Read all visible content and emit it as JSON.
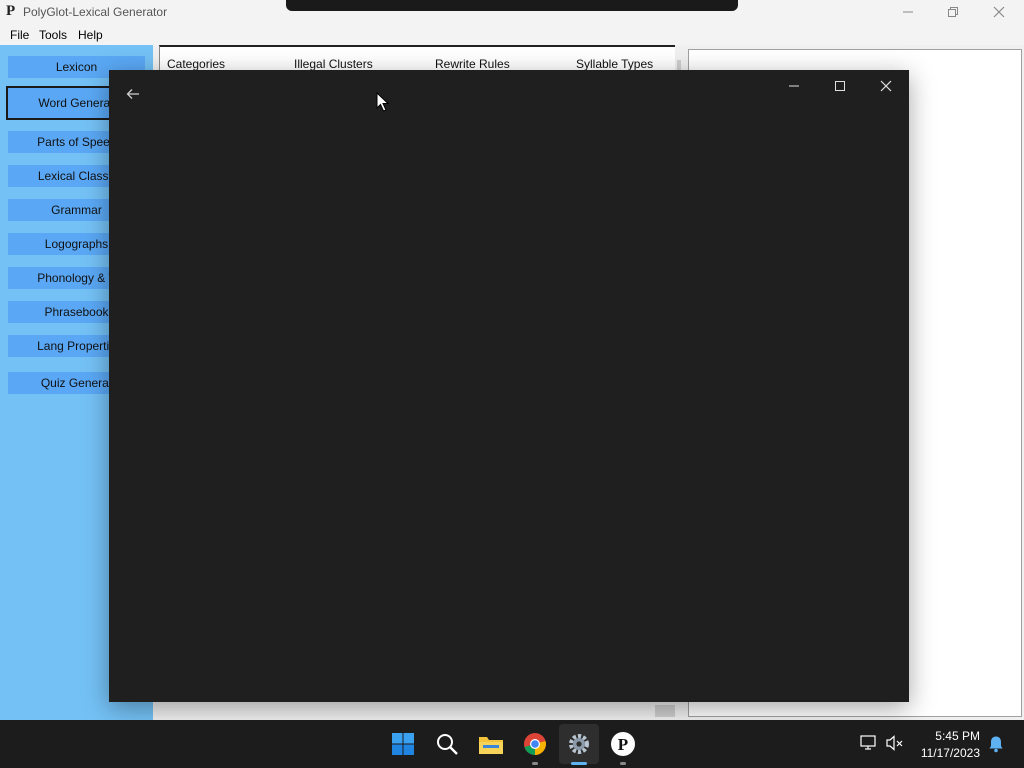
{
  "app": {
    "icon_glyph": "P",
    "title": "PolyGlot-Lexical Generator",
    "window_buttons": [
      "minimize-icon",
      "restore-icon",
      "close-icon"
    ]
  },
  "menu": {
    "file": "File",
    "tools": "Tools",
    "help": "Help"
  },
  "sidebar": {
    "items": [
      {
        "label": "Lexicon"
      },
      {
        "label": "Word Generat",
        "selected": true
      },
      {
        "label": "Parts of Speec"
      },
      {
        "label": "Lexical Classe"
      },
      {
        "label": "Grammar"
      },
      {
        "label": "Logographs"
      },
      {
        "label": "Phonology & T"
      },
      {
        "label": "Phrasebook"
      },
      {
        "label": "Lang Propertie"
      },
      {
        "label": "Quiz Generat"
      }
    ]
  },
  "tabs": {
    "categories": "Categories",
    "illegal_clusters": "Illegal Clusters",
    "rewrite_rules": "Rewrite Rules",
    "syllable_types": "Syllable Types"
  },
  "dialog": {
    "background": "#1f1f1f",
    "buttons": [
      "back-arrow-icon",
      "minimize-icon",
      "maximize-icon",
      "close-icon"
    ]
  },
  "taskbar": {
    "apps": [
      "windows-start-icon",
      "search-icon",
      "file-explorer-icon",
      "chrome-icon",
      "settings-icon",
      "polyglot-icon"
    ],
    "active_app": "settings-icon",
    "polyglot_glyph": "P",
    "time": "5:45 PM",
    "date": "11/17/2023"
  },
  "colors": {
    "sidebar_bg": "#74c1f5",
    "sidebar_button": "#5aa8f5",
    "taskbar_bg": "#1c1c1c",
    "accent": "#5fb2f2"
  }
}
